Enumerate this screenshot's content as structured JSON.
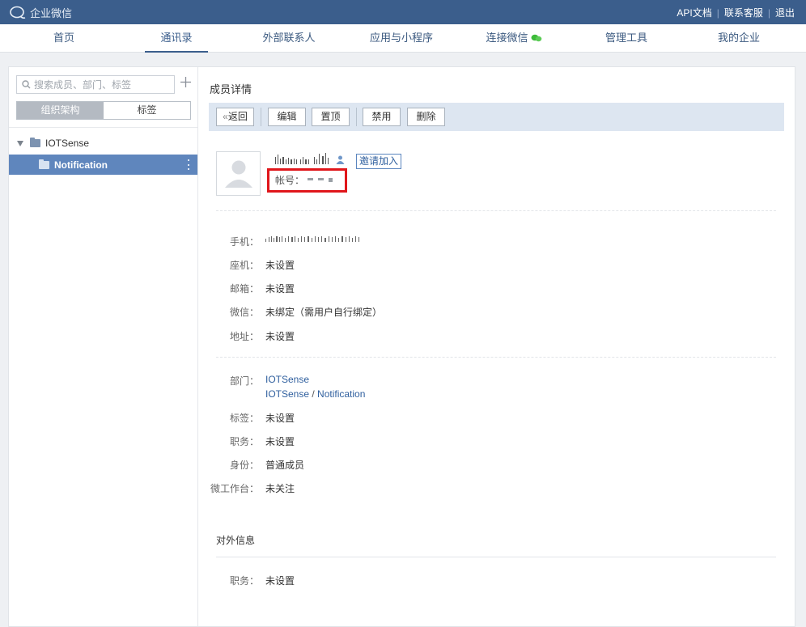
{
  "app": {
    "logo_text": "企业微信"
  },
  "top_links": [
    {
      "label": "API文档"
    },
    {
      "label": "联系客服"
    },
    {
      "label": "退出"
    }
  ],
  "nav": [
    {
      "label": "首页"
    },
    {
      "label": "通讯录",
      "active": true
    },
    {
      "label": "外部联系人"
    },
    {
      "label": "应用与小程序"
    },
    {
      "label": "连接微信"
    },
    {
      "label": "管理工具"
    },
    {
      "label": "我的企业"
    }
  ],
  "sidebar": {
    "search_placeholder": "搜索成员、部门、标签",
    "seg_org": "组织架构",
    "seg_tags": "标签",
    "tree_root": "IOTSense",
    "tree_selected": "Notification"
  },
  "detail": {
    "title": "成员详情",
    "toolbar": {
      "back": "返回",
      "edit": "编辑",
      "pin": "置顶",
      "disable": "禁用",
      "delete": "删除"
    },
    "invite": "邀请加入",
    "account_label": "帐号："
  },
  "fields_contact": [
    {
      "key": "手机：",
      "value": ""
    },
    {
      "key": "座机：",
      "value": "未设置"
    },
    {
      "key": "邮箱：",
      "value": "未设置"
    },
    {
      "key": "微信：",
      "value": "未绑定（需用户自行绑定）"
    },
    {
      "key": "地址：",
      "value": "未设置"
    }
  ],
  "fields_org": {
    "dept_key": "部门：",
    "dept_1": "IOTSense",
    "dept_2_parent": "IOTSense",
    "dept_2_sep": " / ",
    "dept_2_child": "Notification",
    "tag_key": "标签：",
    "tag_value": "未设置",
    "role_key": "职务：",
    "role_value": "未设置",
    "identity_key": "身份：",
    "identity_value": "普通成员",
    "workbench_key": "微工作台：",
    "workbench_value": "未关注"
  },
  "external": {
    "title": "对外信息",
    "role_key": "职务：",
    "role_value": "未设置"
  },
  "colors": {
    "topbar": "#3b5e8c",
    "selected": "#5f86bd",
    "highlight": "#e0161b",
    "link": "#2f5f9e"
  }
}
